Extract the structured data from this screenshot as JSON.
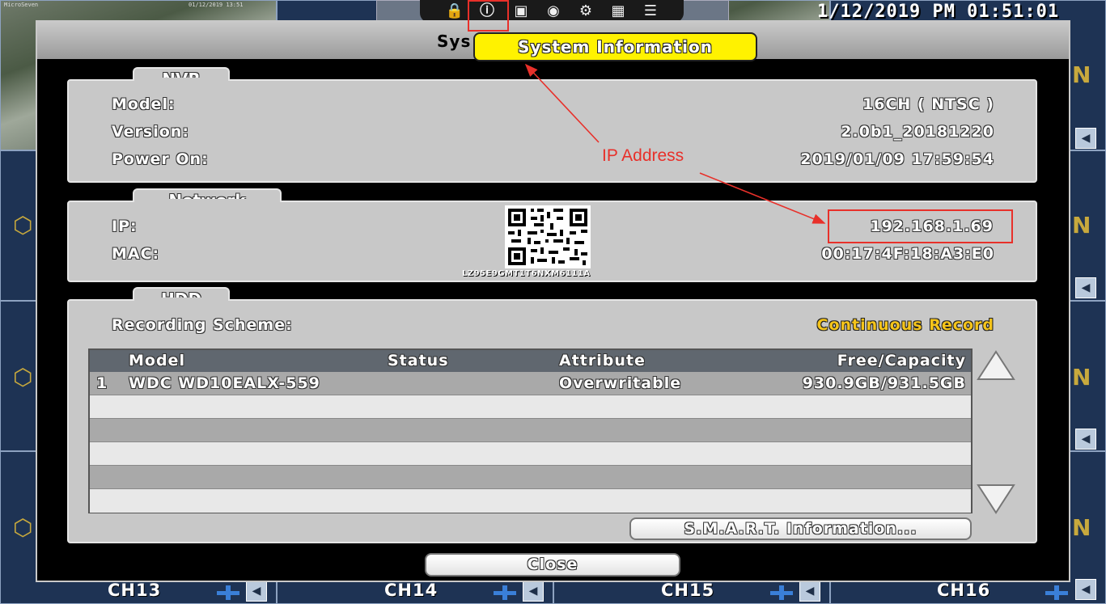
{
  "top": {
    "datetime": "1/12/2019 PM 01:51:01",
    "icons": [
      "lock-icon",
      "info-icon",
      "monitor-icon",
      "camera-icon",
      "settings-icon",
      "image-icon",
      "list-icon"
    ]
  },
  "tooltip": "System Information",
  "dialog": {
    "title": "Sys",
    "nvr": {
      "tab": "NVR",
      "rows": [
        {
          "label": "Model:",
          "value": "16CH ( NTSC )"
        },
        {
          "label": "Version:",
          "value": "2.0b1_20181220"
        },
        {
          "label": "Power On:",
          "value": "2019/01/09 17:59:54"
        }
      ]
    },
    "network": {
      "tab": "Network",
      "ip_label": "IP:",
      "ip_value": "192.168.1.69",
      "mac_label": "MAC:",
      "mac_value": "00:17:4F:18:A3:E0",
      "qr_caption": "LZ95E9GMT1T6NXM6111A"
    },
    "hdd": {
      "tab": "HDD",
      "scheme_label": "Recording Scheme:",
      "scheme_value": "Continuous Record",
      "columns": [
        "Model",
        "Status",
        "Attribute",
        "Free/Capacity"
      ],
      "rows": [
        {
          "index": "1",
          "model": "WDC WD10EALX-559",
          "status": "",
          "attribute": "Overwritable",
          "capacity": "930.9GB/931.5GB"
        }
      ],
      "smart_button": "S.M.A.R.T. Information..."
    },
    "close_button": "Close"
  },
  "annotation": {
    "label": "IP Address",
    "color": "#e8302a"
  },
  "channels": [
    "CH13",
    "CH14",
    "CH15",
    "CH16"
  ]
}
